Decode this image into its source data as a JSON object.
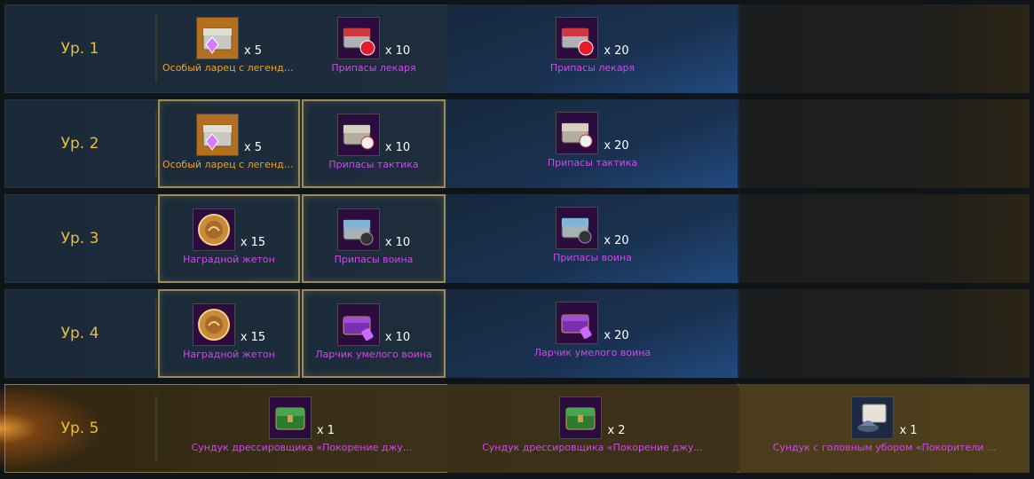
{
  "rows": [
    {
      "level": "Ур. 1",
      "rewards": [
        {
          "name": "Особый ларец с легендар...",
          "qty": "x 5",
          "icon": "legendary-chest-icon"
        },
        {
          "name": "Припасы лекаря",
          "qty": "x 10",
          "icon": "healer-supplies-chest-icon"
        },
        {
          "name": "Припасы лекаря",
          "qty": "x 20",
          "icon": "healer-supplies-chest-icon"
        }
      ]
    },
    {
      "level": "Ур. 2",
      "rewards": [
        {
          "name": "Особый ларец с легендар...",
          "qty": "x 5",
          "icon": "legendary-chest-icon"
        },
        {
          "name": "Припасы тактика",
          "qty": "x 10",
          "icon": "tactician-supplies-chest-icon"
        },
        {
          "name": "Припасы тактика",
          "qty": "x 20",
          "icon": "tactician-supplies-chest-icon"
        }
      ]
    },
    {
      "level": "Ур. 3",
      "rewards": [
        {
          "name": "Наградной жетон",
          "qty": "x 15",
          "icon": "reward-token-icon"
        },
        {
          "name": "Припасы воина",
          "qty": "x 10",
          "icon": "warrior-supplies-chest-icon"
        },
        {
          "name": "Припасы воина",
          "qty": "x 20",
          "icon": "warrior-supplies-chest-icon"
        }
      ]
    },
    {
      "level": "Ур. 4",
      "rewards": [
        {
          "name": "Наградной жетон",
          "qty": "x 15",
          "icon": "reward-token-icon"
        },
        {
          "name": "Ларчик умелого воина",
          "qty": "x 10",
          "icon": "skilled-warrior-box-icon"
        },
        {
          "name": "Ларчик умелого воина",
          "qty": "x 20",
          "icon": "skilled-warrior-box-icon"
        }
      ]
    },
    {
      "level": "Ур. 5",
      "rewards": [
        {
          "name": "Сундук дрессировщика «Покорение джу...",
          "qty": "x 1",
          "icon": "trainer-chest-icon"
        },
        {
          "name": "Сундук дрессировщика «Покорение джу...",
          "qty": "x 2",
          "icon": "trainer-chest-icon"
        },
        {
          "name": "Сундук с головным убором «Покорители ...",
          "qty": "x 1",
          "icon": "headgear-chest-icon"
        }
      ]
    }
  ],
  "colors": {
    "level_text": "#e9bd3c",
    "legendary_name": "#f3a321",
    "epic_name": "#d347ec",
    "highlight_border": "#9f8b55"
  }
}
